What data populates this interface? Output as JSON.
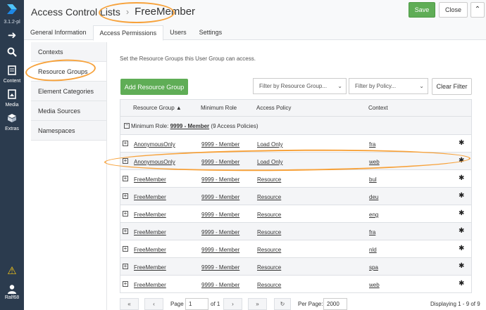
{
  "app": {
    "version": "3.1.2-pl",
    "nav": [
      {
        "label": "",
        "icon": "arrow-right-icon"
      },
      {
        "label": "",
        "icon": "search-icon"
      },
      {
        "label": "Content",
        "icon": "content-icon"
      },
      {
        "label": "Media",
        "icon": "media-icon"
      },
      {
        "label": "Extras",
        "icon": "extras-icon"
      }
    ],
    "user": "Ralf68"
  },
  "header": {
    "breadcrumb_parent": "Access Control Lists",
    "breadcrumb_sep": "›",
    "title": "FreeMember",
    "save_label": "Save",
    "close_label": "Close"
  },
  "tabs": [
    "General Information",
    "Access Permissions",
    "Users",
    "Settings"
  ],
  "vtabs": [
    "Contexts",
    "Resource Groups",
    "Element Categories",
    "Media Sources",
    "Namespaces"
  ],
  "description": "Set the Resource Groups this User Group can access.",
  "toolbar": {
    "add_label": "Add Resource Group",
    "filter_rg_placeholder": "Filter by Resource Group...",
    "filter_policy_placeholder": "Filter by Policy...",
    "clear_label": "Clear Filter"
  },
  "grid": {
    "columns": [
      "Resource Group ▲",
      "Minimum Role",
      "Access Policy",
      "Context"
    ],
    "group": {
      "prefix": "Minimum Role:",
      "role": "9999 - Member",
      "suffix": "(9 Access Policies)"
    },
    "rows": [
      {
        "group": "AnonymousOnly",
        "role": "9999 - Member",
        "policy": "Load Only",
        "context": "fra"
      },
      {
        "group": "AnonymousOnly",
        "role": "9999 - Member",
        "policy": "Load Only",
        "context": "web"
      },
      {
        "group": "FreeMember",
        "role": "9999 - Member",
        "policy": "Resource",
        "context": "bul"
      },
      {
        "group": "FreeMember",
        "role": "9999 - Member",
        "policy": "Resource",
        "context": "deu"
      },
      {
        "group": "FreeMember",
        "role": "9999 - Member",
        "policy": "Resource",
        "context": "eng"
      },
      {
        "group": "FreeMember",
        "role": "9999 - Member",
        "policy": "Resource",
        "context": "fra"
      },
      {
        "group": "FreeMember",
        "role": "9999 - Member",
        "policy": "Resource",
        "context": "nld"
      },
      {
        "group": "FreeMember",
        "role": "9999 - Member",
        "policy": "Resource",
        "context": "spa"
      },
      {
        "group": "FreeMember",
        "role": "9999 - Member",
        "policy": "Resource",
        "context": "web"
      }
    ]
  },
  "pager": {
    "page_label": "Page",
    "page_value": "1",
    "of_label": "of 1",
    "per_page_label": "Per Page:",
    "per_page_value": "2000",
    "displaying": "Displaying 1 - 9 of 9"
  },
  "colors": {
    "accent_green": "#5fad56",
    "sidebar": "#2b3b4e",
    "annotation": "#f7a23b"
  }
}
